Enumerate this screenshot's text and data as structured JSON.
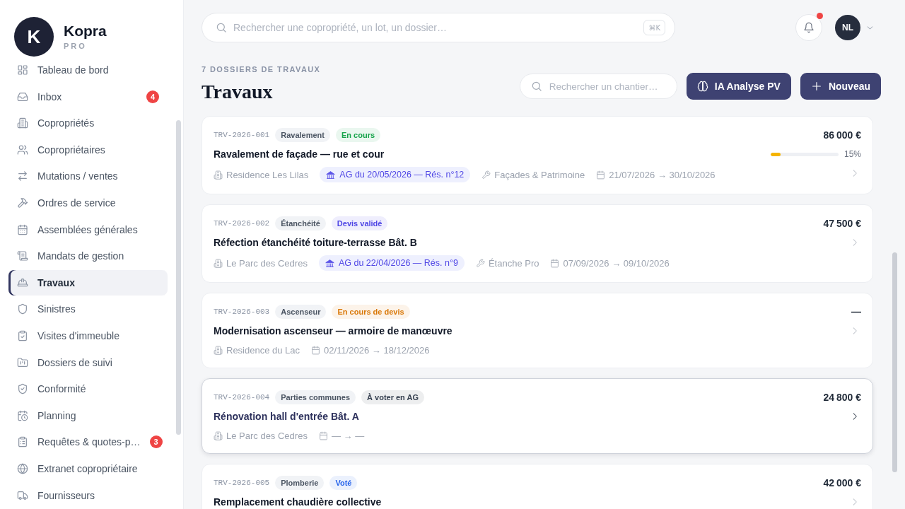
{
  "sidebar": {
    "logo": {
      "mark": "K",
      "name": "Kopra",
      "tier": "PRO"
    },
    "nav": [
      {
        "label": "Tableau de bord",
        "selected": false
      },
      {
        "label": "Inbox",
        "selected": false,
        "badge": "4"
      },
      {
        "label": "Copropriétés",
        "selected": false
      },
      {
        "label": "Copropriétaires",
        "selected": false
      },
      {
        "label": "Mutations / ventes",
        "selected": false
      },
      {
        "label": "Ordres de service",
        "selected": false
      },
      {
        "label": "Assemblées générales",
        "selected": false
      },
      {
        "label": "Mandats de gestion",
        "selected": false
      },
      {
        "label": "Travaux",
        "selected": true
      },
      {
        "label": "Sinistres",
        "selected": false
      },
      {
        "label": "Visites d'immeuble",
        "selected": false
      },
      {
        "label": "Dossiers de suivi",
        "selected": false
      },
      {
        "label": "Conformité",
        "selected": false
      },
      {
        "label": "Planning",
        "selected": false
      },
      {
        "label": "Requêtes & quotes-p…",
        "selected": false,
        "badge": "3"
      },
      {
        "label": "Extranet copropriétaire",
        "selected": false
      },
      {
        "label": "Fournisseurs",
        "selected": false
      }
    ]
  },
  "topbar": {
    "search": {
      "placeholder": "Rechercher une copropriété, un lot, un dossier…",
      "shortcut": "⌘K"
    },
    "notifications": {
      "unread": true
    },
    "user": {
      "initials": "NL"
    }
  },
  "page": {
    "count_label": "7 DOSSIERS DE TRAVAUX",
    "title": "Travaux",
    "search": {
      "placeholder": "Rechercher un chantier…"
    },
    "actions": [
      {
        "label": "IA Analyse PV",
        "kind": "ai"
      },
      {
        "label": "Nouveau",
        "kind": "new"
      }
    ]
  },
  "cards": [
    {
      "code": "TRV-2026-001",
      "category": "Ravalement",
      "status": {
        "label": "En cours",
        "color": "#16a34a"
      },
      "amount": "86 000 €",
      "title": "Ravalement de façade — rue et cour",
      "progress": {
        "level": 0.15,
        "reading": "15%"
      },
      "meta": [
        {
          "kind": "residence",
          "text": "Residence Les Lilas"
        },
        {
          "kind": "ag",
          "text": "AG du 20/05/2026 — Rés. n°12"
        },
        {
          "kind": "provider",
          "text": "Façades & Patrimoine"
        },
        {
          "kind": "dates",
          "text": "21/07/2026 → 30/10/2026"
        }
      ],
      "hovered": false
    },
    {
      "code": "TRV-2026-002",
      "category": "Étanchéité",
      "status": {
        "label": "Devis validé",
        "color": "#4f46e5"
      },
      "amount": "47 500 €",
      "title": "Réfection étanchéité toiture-terrasse Bât. B",
      "meta": [
        {
          "kind": "residence",
          "text": "Le Parc des Cedres"
        },
        {
          "kind": "ag",
          "text": "AG du 22/04/2026 — Rés. n°9"
        },
        {
          "kind": "provider",
          "text": "Étanche Pro"
        },
        {
          "kind": "dates",
          "text": "07/09/2026 → 09/10/2026"
        }
      ],
      "hovered": false
    },
    {
      "code": "TRV-2026-003",
      "category": "Ascenseur",
      "status": {
        "label": "En cours de devis",
        "color": "#d97706"
      },
      "amount": "—",
      "title": "Modernisation ascenseur — armoire de manœuvre",
      "meta": [
        {
          "kind": "residence",
          "text": "Residence du Lac"
        },
        {
          "kind": "dates",
          "text": "02/11/2026 → 18/12/2026"
        }
      ],
      "hovered": false
    },
    {
      "code": "TRV-2026-004",
      "category": "Parties communes",
      "status": {
        "label": "À voter en AG",
        "color": "#374151"
      },
      "amount": "24 800 €",
      "title": "Rénovation hall d'entrée Bât. A",
      "meta": [
        {
          "kind": "residence",
          "text": "Le Parc des Cedres"
        },
        {
          "kind": "dates",
          "text": "— → —"
        }
      ],
      "hovered": true
    },
    {
      "code": "TRV-2026-005",
      "category": "Plomberie",
      "status": {
        "label": "Voté",
        "color": "#2563eb"
      },
      "amount": "42 000 €",
      "title": "Remplacement chaudière collective",
      "hovered": false
    }
  ]
}
